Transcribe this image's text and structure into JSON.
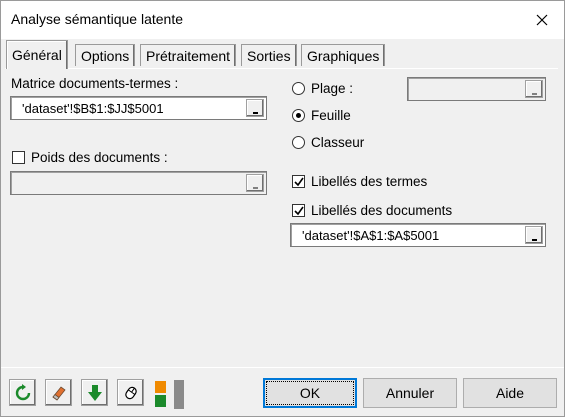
{
  "window": {
    "title": "Analyse sémantique latente"
  },
  "tabs": [
    {
      "label": "Général"
    },
    {
      "label": "Options"
    },
    {
      "label": "Prétraitement"
    },
    {
      "label": "Sorties"
    },
    {
      "label": "Graphiques"
    }
  ],
  "general": {
    "matrix_label": "Matrice documents-termes :",
    "matrix_value": "'dataset'!$B$1:$JJ$5001",
    "weights_label": "Poids des documents :",
    "weights_checked": false,
    "weights_value": "",
    "range_options": [
      {
        "label": "Plage :",
        "checked": false
      },
      {
        "label": "Feuille",
        "checked": true
      },
      {
        "label": "Classeur",
        "checked": false
      }
    ],
    "range_value": "",
    "term_labels": {
      "label": "Libellés des termes",
      "checked": true
    },
    "doc_labels": {
      "label": "Libellés des documents",
      "checked": true
    },
    "doc_labels_value": "'dataset'!$A$1:$A$5001"
  },
  "toolbar": {
    "icons": [
      "refresh-icon",
      "eraser-icon",
      "down-arrow-icon",
      "mouse-icon",
      "layout-icon"
    ]
  },
  "buttons": {
    "ok": "OK",
    "cancel": "Annuler",
    "help": "Aide"
  },
  "colors": {
    "accent": "#0078d7",
    "dialog_bg": "#f0f0f0",
    "green_icon": "#1b8a2b",
    "orange_icon": "#f08a00"
  }
}
